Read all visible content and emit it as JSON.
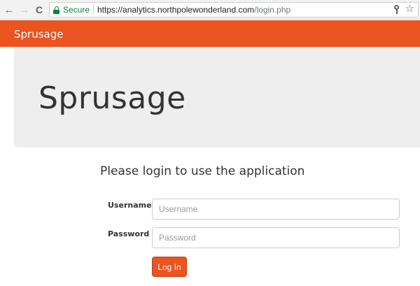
{
  "browser": {
    "back_glyph": "←",
    "forward_glyph": "→",
    "reload_glyph": "C",
    "secure_label": "Secure",
    "url_scheme_host": "https://analytics.northpolewonderland.com",
    "url_path": "/login.php",
    "star_glyph": "☆"
  },
  "navbar": {
    "brand": "Sprusage"
  },
  "jumbotron": {
    "title": "Sprusage"
  },
  "login": {
    "heading": "Please login to use the application",
    "username_label": "Username",
    "username_placeholder": "Username",
    "password_label": "Password",
    "password_placeholder": "Password",
    "submit_label": "Log In"
  },
  "colors": {
    "accent": "#e95420",
    "secure": "#0b8043",
    "jumbotron_bg": "#eeeeee"
  }
}
